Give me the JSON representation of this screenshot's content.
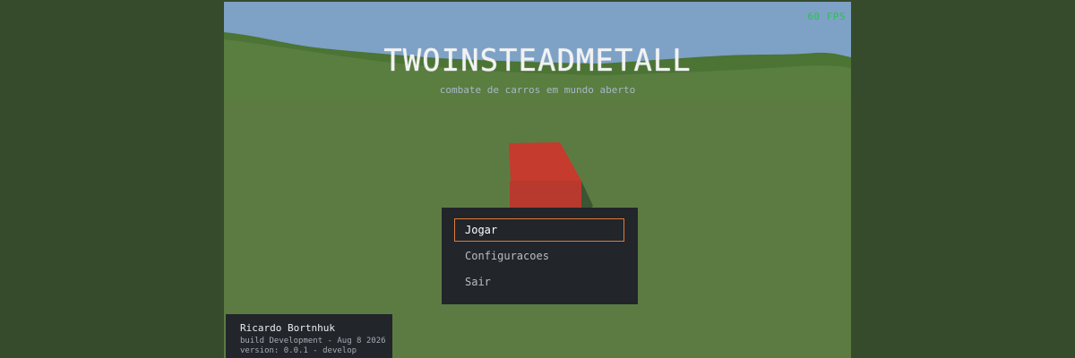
{
  "hud": {
    "fps": "60 FPS"
  },
  "title": {
    "text": "TWOINSTEADMETALL",
    "subtitle": "combate de carros em mundo aberto"
  },
  "menu": {
    "items": [
      {
        "label": "Jogar",
        "selected": true
      },
      {
        "label": "Configuracoes",
        "selected": false
      },
      {
        "label": "Sair",
        "selected": false
      }
    ],
    "selection_color": "#e07a3a"
  },
  "credits": {
    "author": "Ricardo Bortnhuk",
    "build": "build Development - Aug  8 2026",
    "version": "version: 0.0.1 - develop"
  },
  "colors": {
    "sky": "#7ea1c6",
    "grass": "#5c7b42",
    "hills": "#4b7435",
    "car": "#c93c2e",
    "panel": "#22252a",
    "outer_background": "#364b2b"
  }
}
